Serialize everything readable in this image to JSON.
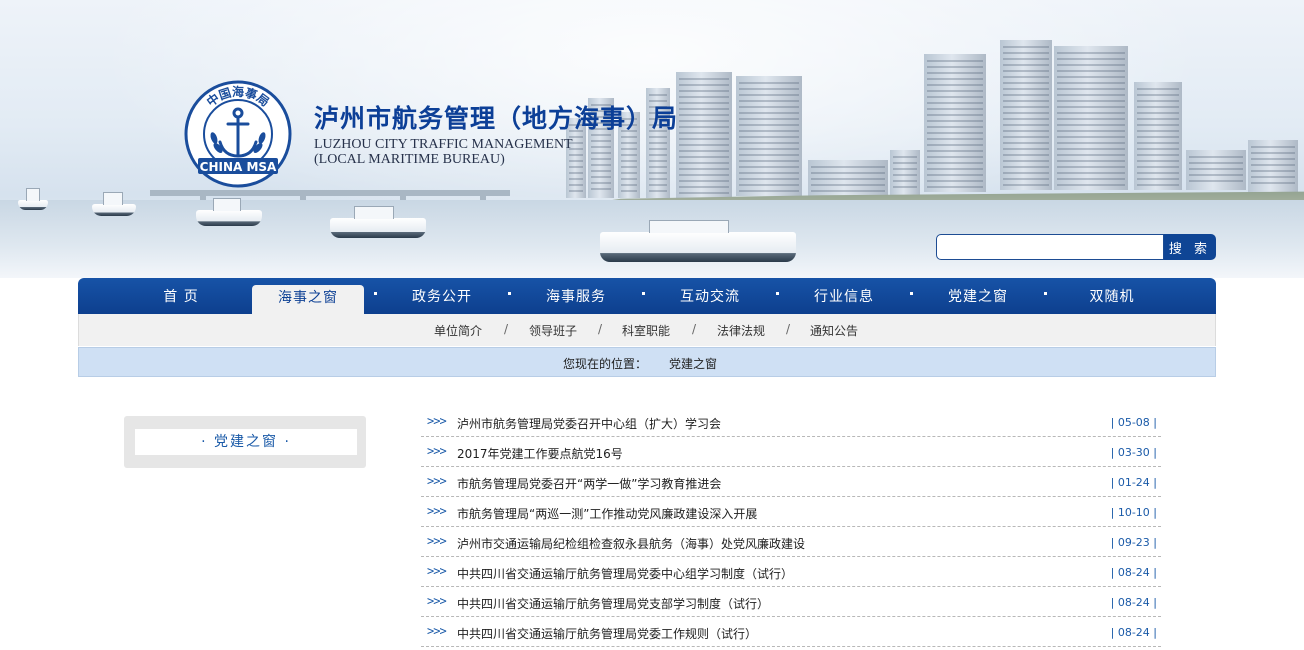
{
  "header": {
    "title_cn": "泸州市航务管理（地方海事）局",
    "title_en_line1": "LUZHOU CITY TRAFFIC MANAGEMENT",
    "title_en_line2": "(LOCAL MARITIME BUREAU)",
    "logo": {
      "top_text": "中国海事局",
      "bottom_text": "CHINA MSA",
      "icon": "anchor-icon"
    }
  },
  "search": {
    "value": "",
    "placeholder": "",
    "button_label": "搜 索"
  },
  "nav": {
    "items": [
      {
        "label": "首 页",
        "active": false
      },
      {
        "label": "海事之窗",
        "active": true
      },
      {
        "label": "政务公开",
        "active": false
      },
      {
        "label": "海事服务",
        "active": false
      },
      {
        "label": "互动交流",
        "active": false
      },
      {
        "label": "行业信息",
        "active": false
      },
      {
        "label": "党建之窗",
        "active": false
      },
      {
        "label": "双随机",
        "active": false
      }
    ]
  },
  "subnav": {
    "items": [
      "单位简介",
      "领导班子",
      "科室职能",
      "法律法规",
      "通知公告"
    ],
    "separator": "/"
  },
  "breadcrumb": {
    "label": "您现在的位置：",
    "current": "党建之窗"
  },
  "sidebar": {
    "heading": "· 党建之窗 ·"
  },
  "articles": {
    "bullet": ">>>",
    "items": [
      {
        "title": "泸州市航务管理局党委召开中心组（扩大）学习会",
        "date": "| 05-08 |"
      },
      {
        "title": "2017年党建工作要点航党16号",
        "date": "| 03-30 |"
      },
      {
        "title": "市航务管理局党委召开“两学一做”学习教育推进会",
        "date": "| 01-24 |"
      },
      {
        "title": "市航务管理局“两巡一测”工作推动党风廉政建设深入开展",
        "date": "| 10-10 |"
      },
      {
        "title": "泸州市交通运输局纪检组检查叙永县航务（海事）处党风廉政建设",
        "date": "| 09-23 |"
      },
      {
        "title": "中共四川省交通运输厅航务管理局党委中心组学习制度（试行）",
        "date": "| 08-24 |"
      },
      {
        "title": "中共四川省交通运输厅航务管理局党支部学习制度（试行）",
        "date": "| 08-24 |"
      },
      {
        "title": "中共四川省交通运输厅航务管理局党委工作规则（试行）",
        "date": "| 08-24 |"
      }
    ]
  },
  "colors": {
    "nav_blue": "#0f4595",
    "link_blue": "#1a5aa8",
    "title_blue": "#0c3f97",
    "breadcrumb_bg": "#cfe0f4"
  }
}
